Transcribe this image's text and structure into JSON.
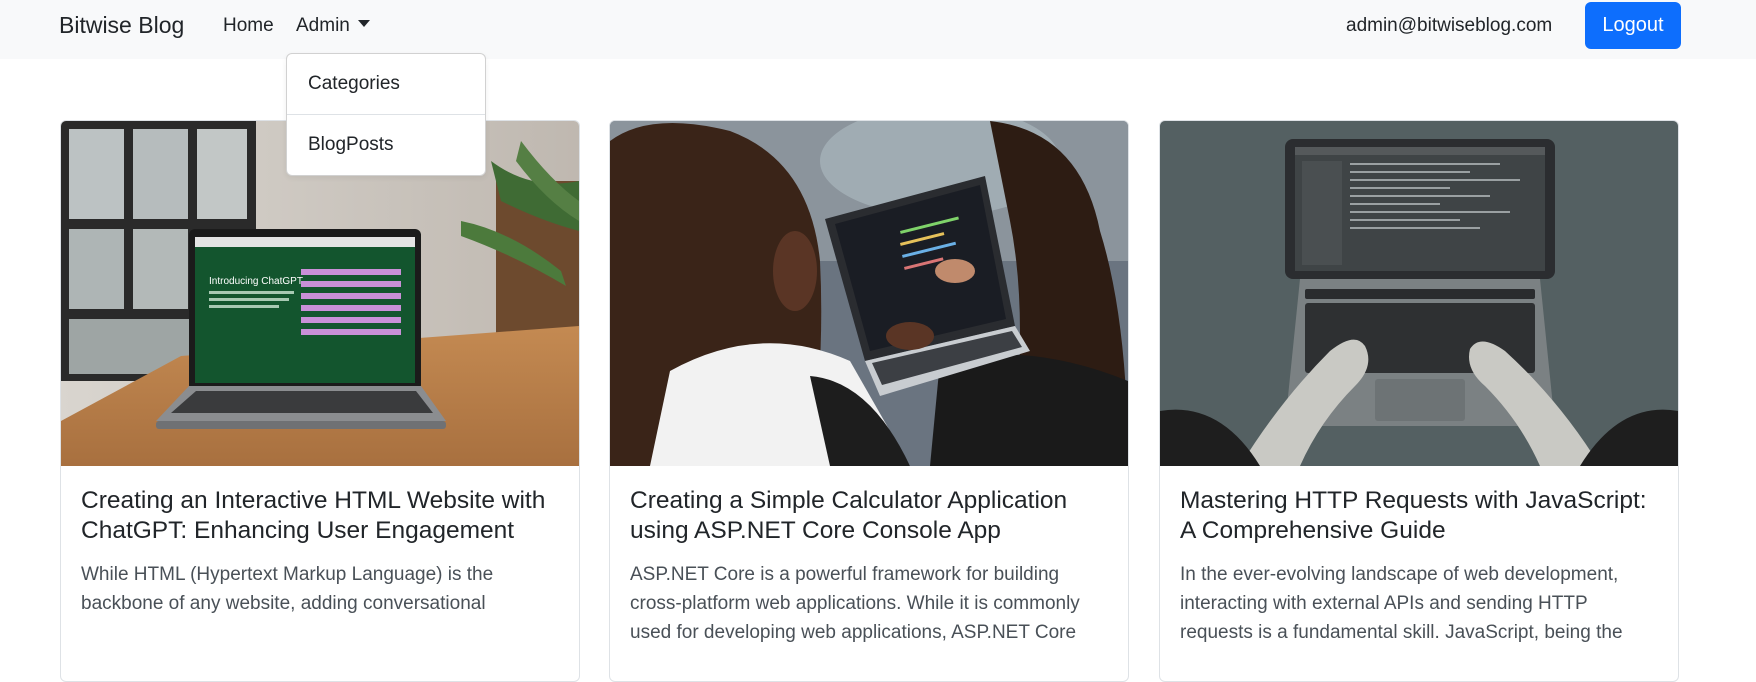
{
  "navbar": {
    "brand": "Bitwise Blog",
    "home_label": "Home",
    "admin_label": "Admin",
    "user_email": "admin@bitwiseblog.com",
    "logout_label": "Logout"
  },
  "dropdown": {
    "items": [
      {
        "label": "Categories"
      },
      {
        "label": "BlogPosts"
      }
    ]
  },
  "posts": [
    {
      "title": "Creating an Interactive HTML Website with ChatGPT: Enhancing User Engagement",
      "excerpt": "While HTML (Hypertext Markup Language) is the backbone of any website, adding conversational",
      "image_text": "Introducing ChatGPT"
    },
    {
      "title": "Creating a Simple Calculator Application using ASP.NET Core Console App",
      "excerpt": "ASP.NET Core is a powerful framework for building cross-platform web applications. While it is commonly used for developing web applications, ASP.NET Core"
    },
    {
      "title": "Mastering HTTP Requests with JavaScript: A Comprehensive Guide",
      "excerpt": "In the ever-evolving landscape of web development, interacting with external APIs and sending HTTP requests is a fundamental skill. JavaScript, being the"
    }
  ],
  "colors": {
    "primary": "#0d6efd",
    "navbar_bg": "#f8f9fa"
  }
}
